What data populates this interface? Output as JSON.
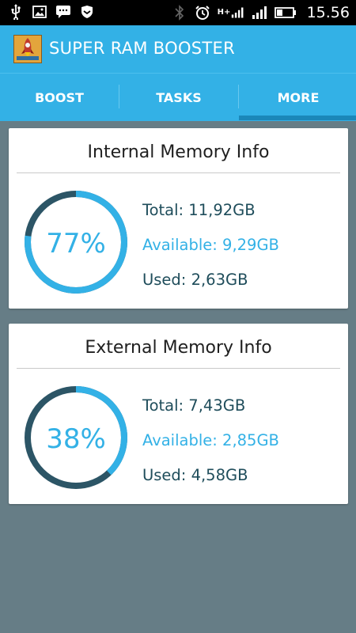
{
  "status_bar": {
    "time": "15.56",
    "network": "H+",
    "icons": [
      "usb-icon",
      "image-icon",
      "chat-icon",
      "shield-icon",
      "bluetooth-icon",
      "alarm-icon",
      "signal-icon",
      "signal2-icon",
      "battery-icon"
    ]
  },
  "app": {
    "title": "SUPER RAM BOOSTER",
    "logo_icon": "rocket-icon"
  },
  "tabs": [
    {
      "label": "BOOST"
    },
    {
      "label": "TASKS"
    },
    {
      "label": "MORE",
      "selected": true
    }
  ],
  "internal": {
    "title": "Internal Memory Info",
    "percent_label": "77%",
    "percent": 77,
    "total": "Total: 11,92GB",
    "available": "Available: 9,29GB",
    "used": "Used: 2,63GB"
  },
  "external": {
    "title": "External Memory Info",
    "percent_label": "38%",
    "percent": 38,
    "total": "Total: 7,43GB",
    "available": "Available: 2,85GB",
    "used": "Used: 4,58GB"
  },
  "colors": {
    "accent": "#33b1e6",
    "ring_track": "#2c5566",
    "background": "#667d86",
    "text_dark": "#1f4d5b"
  }
}
